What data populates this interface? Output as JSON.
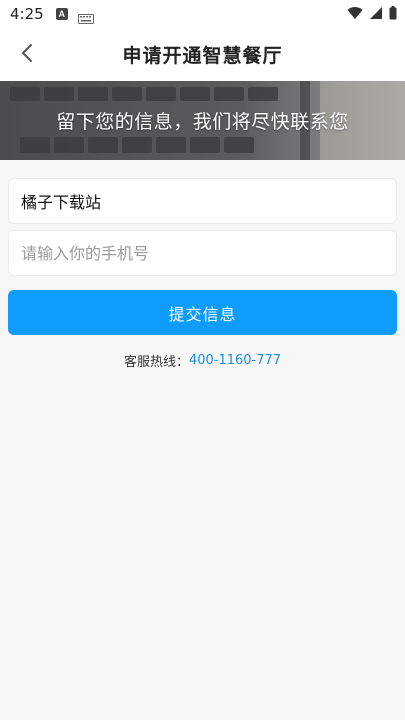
{
  "status_bar": {
    "time": "4:25",
    "notification_letter": "A"
  },
  "header": {
    "title": "申请开通智慧餐厅"
  },
  "banner": {
    "text": "留下您的信息，我们将尽快联系您"
  },
  "form": {
    "name_value": "橘子下载站",
    "phone_placeholder": "请输入你的手机号",
    "submit_label": "提交信息"
  },
  "hotline": {
    "label": "客服热线：",
    "number": "400-1160-777"
  },
  "colors": {
    "primary": "#0e9cff",
    "link": "#1a8fe0",
    "background": "#f7f7f7"
  }
}
